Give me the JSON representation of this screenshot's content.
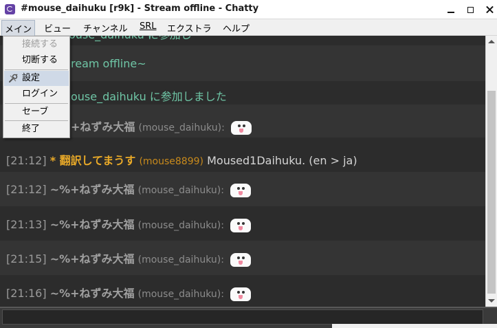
{
  "window": {
    "title": "#mouse_daihuku [r9k] - Stream offline - Chatty"
  },
  "menubar": {
    "items": [
      {
        "label": "メイン"
      },
      {
        "label": "ビュー"
      },
      {
        "label": "チャンネル"
      },
      {
        "label": "SRL"
      },
      {
        "label": "エクストラ"
      },
      {
        "label": "ヘルプ"
      }
    ]
  },
  "main_menu": {
    "items": [
      {
        "label": "接続する",
        "enabled": false
      },
      {
        "label": "切断する",
        "enabled": true
      },
      {
        "label": "設定",
        "enabled": true,
        "icon": "wrench-icon"
      },
      {
        "label": "ログイン",
        "enabled": true
      },
      {
        "label": "セーブ",
        "enabled": true
      },
      {
        "label": "終了",
        "enabled": true
      }
    ]
  },
  "chat": {
    "partial_top": "ouse_daihuku に参加し",
    "partial_stream": "ream offline~",
    "partial_join": "ouse_daihuku に参加しました",
    "partial_nick": "+ねずみ大福",
    "partial_uid": "(mouse_daihuku):",
    "translator": {
      "time": "[21:12]",
      "nick": "* 翻訳してまうす",
      "uid": "(mouse8899)",
      "message": "Moused1Daihuku. (en > ja)"
    },
    "messages": [
      {
        "time": "[21:12]",
        "nick": "~%+ねずみ大福",
        "uid": "(mouse_daihuku):"
      },
      {
        "time": "[21:13]",
        "nick": "~%+ねずみ大福",
        "uid": "(mouse_daihuku):"
      },
      {
        "time": "[21:15]",
        "nick": "~%+ねずみ大福",
        "uid": "(mouse_daihuku):"
      },
      {
        "time": "[21:16]",
        "nick": "~%+ねずみ大福",
        "uid": "(mouse_daihuku):"
      }
    ]
  },
  "colors": {
    "chat_bg": "#2c2c2c",
    "system_text": "#6fc6a6",
    "translator_nick": "#e8a928"
  }
}
